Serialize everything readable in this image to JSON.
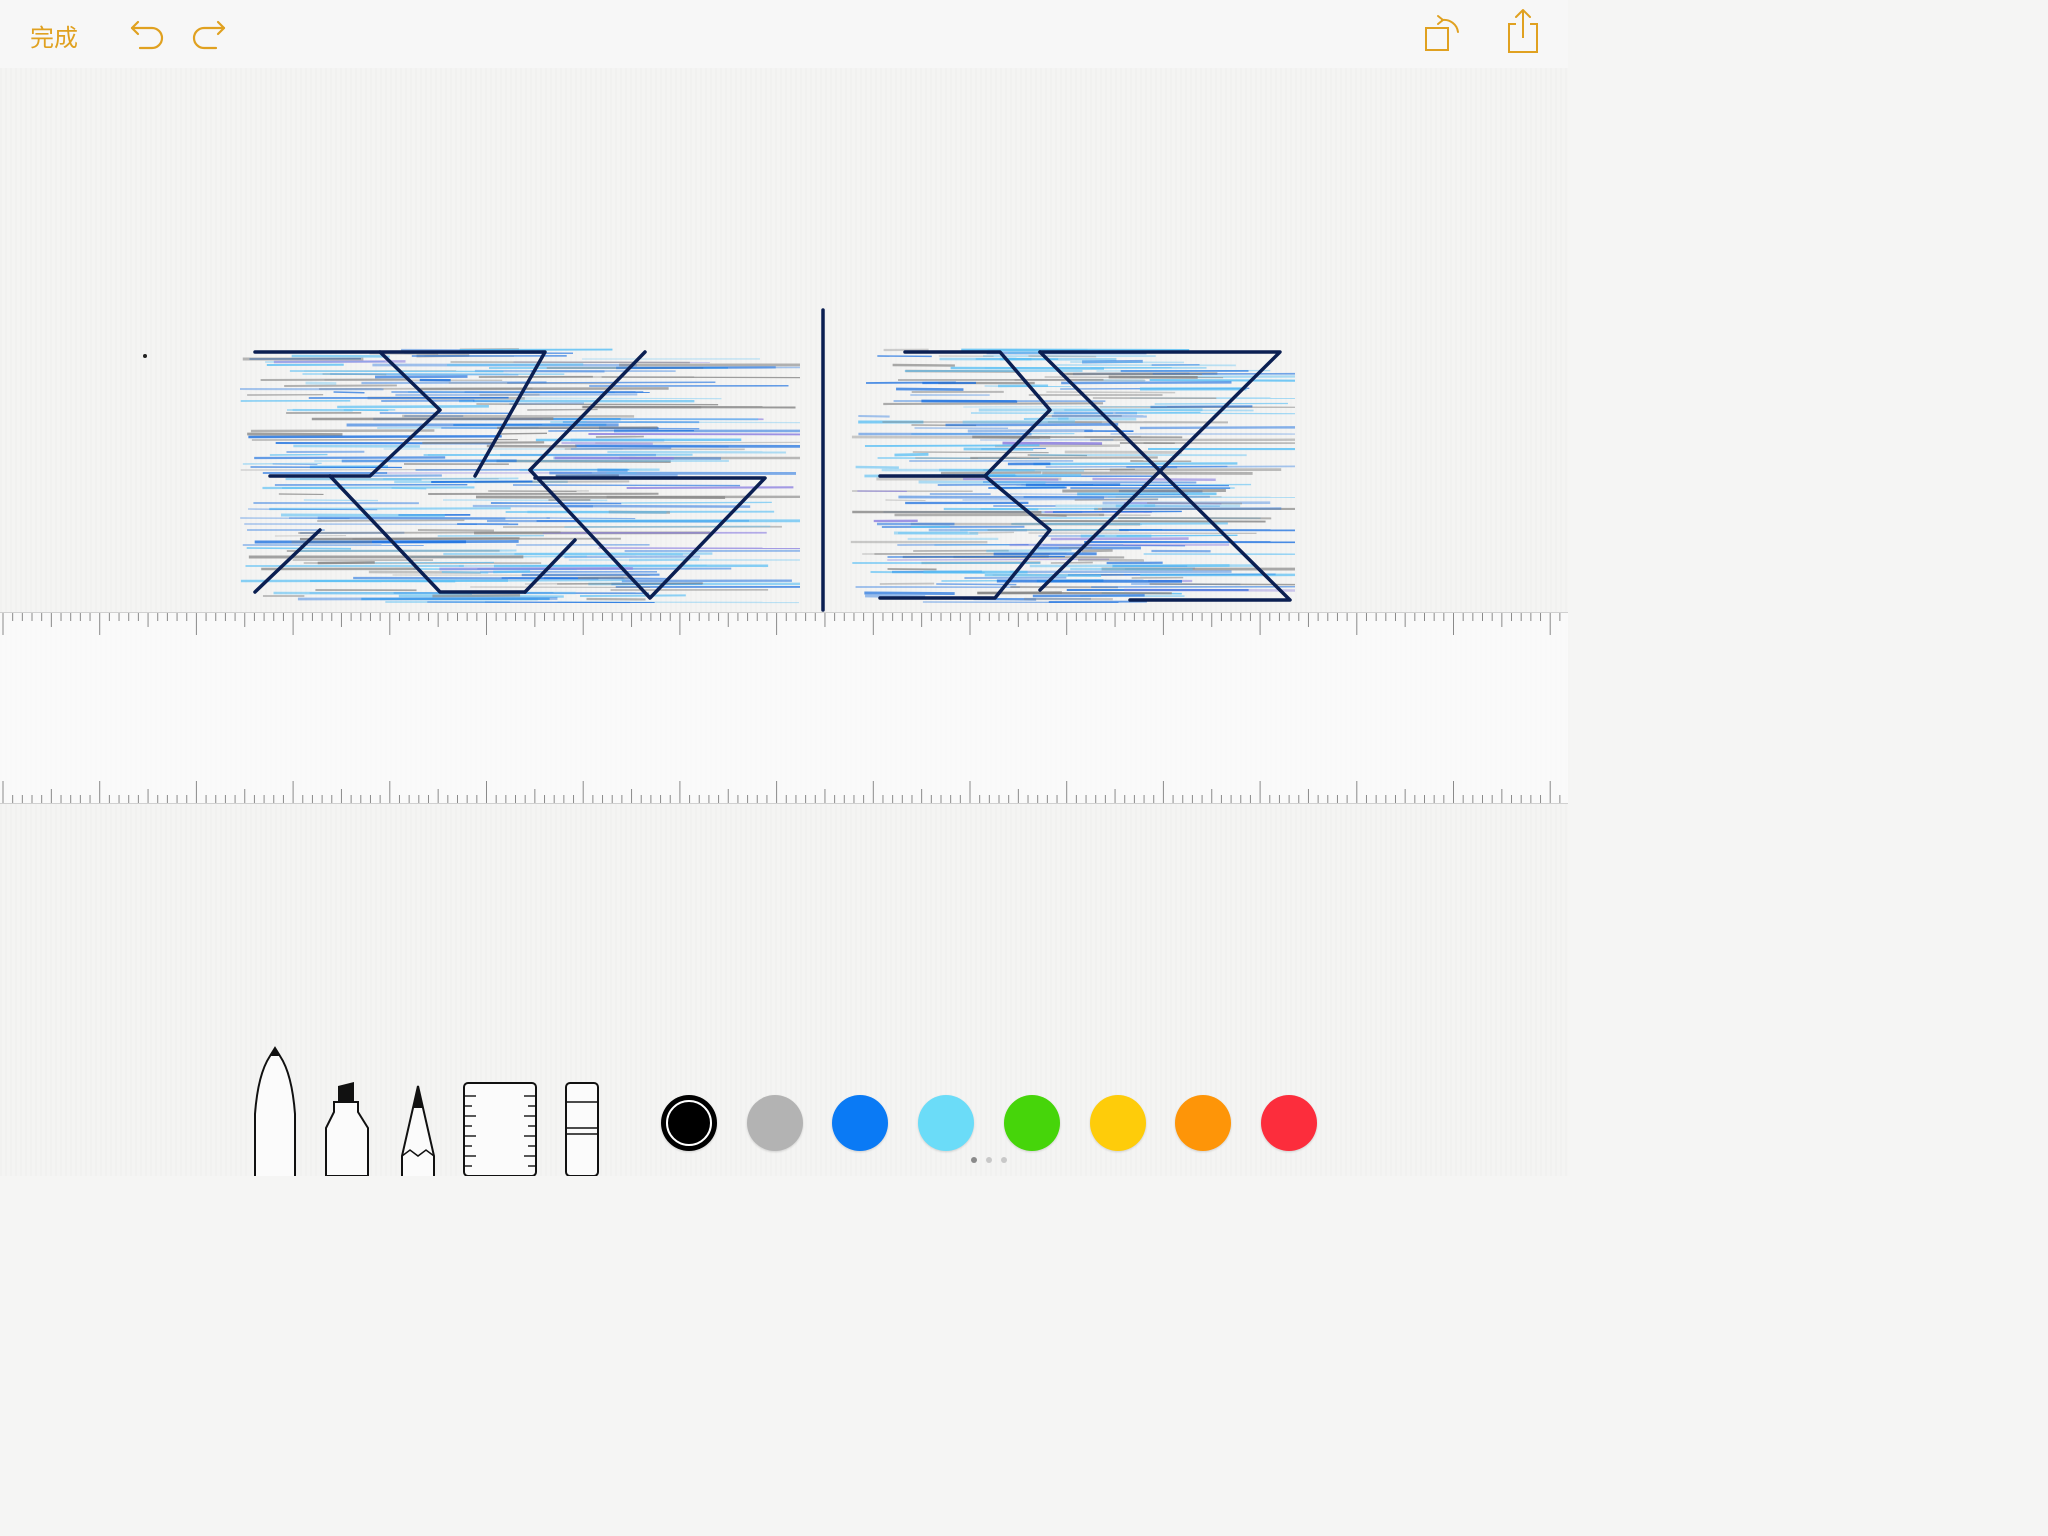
{
  "header": {
    "done_label": "完成",
    "accent_color": "#e0a120",
    "icons": [
      "undo-icon",
      "redo-icon",
      "rotate-icon",
      "share-icon"
    ]
  },
  "drawing": {
    "description_icon": "sketch-drawing",
    "colors_used": [
      "#1a6fe0",
      "#5bc0f5",
      "#000000",
      "#888888",
      "#8a7de0"
    ]
  },
  "tools": [
    "pen-tool",
    "marker-tool",
    "pencil-tool",
    "ruler-tool",
    "eraser-tool"
  ],
  "palette": {
    "colors": [
      {
        "name": "black",
        "hex": "#000000",
        "selected": true
      },
      {
        "name": "gray",
        "hex": "#b3b3b3",
        "selected": false
      },
      {
        "name": "blue",
        "hex": "#0a7af5",
        "selected": false
      },
      {
        "name": "light-blue",
        "hex": "#6bdcf8",
        "selected": false
      },
      {
        "name": "green",
        "hex": "#46d50a",
        "selected": false
      },
      {
        "name": "yellow",
        "hex": "#fecc0a",
        "selected": false
      },
      {
        "name": "orange",
        "hex": "#fe9508",
        "selected": false
      },
      {
        "name": "red",
        "hex": "#fc2d3c",
        "selected": false
      }
    ]
  },
  "page_indicator": {
    "count": 3,
    "active_index": 0
  }
}
